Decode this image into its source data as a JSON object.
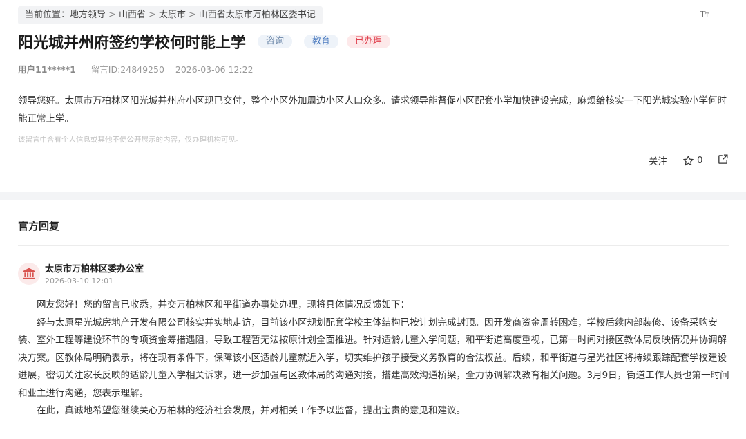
{
  "breadcrumb": {
    "prefix": "当前位置：",
    "items": [
      "地方领导",
      "山西省",
      "太原市",
      "山西省太原市万柏林区委书记"
    ],
    "separator": ">"
  },
  "font_size_button": "Tт",
  "question": {
    "title": "阳光城并州府签约学校何时能上学",
    "tags": {
      "consult": "咨询",
      "education": "教育",
      "status": "已办理"
    },
    "user": "用户11*****1",
    "message_id": "留言ID:24849250",
    "datetime": "2026-03-06 12:22",
    "content": "领导您好。太原市万柏林区阳光城并州府小区现已交付，整个小区外加周边小区人口众多。请求领导能督促小区配套小学加快建设完成，麻烦给核实一下阳光城实验小学何时能正常上学。",
    "privacy_note": "该留言中含有个人信息或其他不便公开展示的内容，仅办理机构可见。",
    "follow_label": "关注",
    "star_count": "0"
  },
  "reply": {
    "heading": "官方回复",
    "org_name": "太原市万柏林区委办公室",
    "datetime": "2026-03-10 12:01",
    "paragraphs": [
      "网友您好！您的留言已收悉，并交万柏林区和平街道办事处办理，现将具体情况反馈如下：",
      "经与太原星光城房地产开发有限公司核实并实地走访，目前该小区规划配套学校主体结构已按计划完成封顶。因开发商资金周转困难，学校后续内部装修、设备采购安装、室外工程等建设环节的专项资金筹措遇阻，导致工程暂无法按原计划全面推进。针对适龄儿童入学问题，和平街道高度重视，已第一时间对接区教体局反映情况并协调解决方案。区教体局明确表示，将在现有条件下，保障该小区适龄儿童就近入学，切实维护孩子接受义务教育的合法权益。后续，和平街道与星光社区将持续跟踪配套学校建设进展，密切关注家长反映的适龄儿童入学相关诉求，进一步加强与区教体局的沟通对接，搭建高效沟通桥梁，全力协调解决教育相关问题。3月9日，街道工作人员也第一时间和业主进行沟通，您表示理解。",
      "在此，真诚地希望您继续关心万柏林的经济社会发展，并对相关工作予以监督，提出宝贵的意见和建议。"
    ]
  },
  "colors": {
    "status_tag_text": "#e0404d",
    "status_tag_bg": "#fde9ea",
    "tag_bg": "#eef3f9",
    "avatar_icon": "#d9534f"
  },
  "icons": [
    "font-size-icon",
    "star-icon",
    "share-icon",
    "government-building-icon"
  ]
}
